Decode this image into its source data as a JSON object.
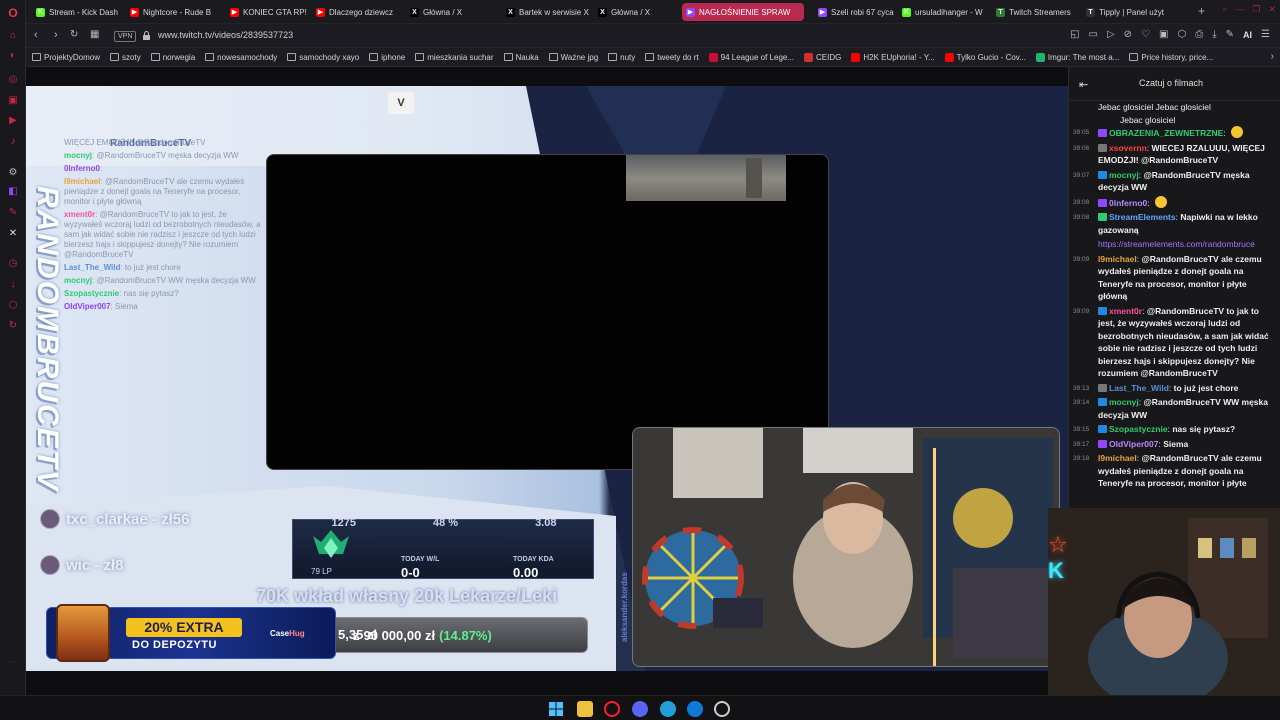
{
  "browser": {
    "tabs": [
      {
        "label": "Stream - Kick Dash",
        "fav": "K",
        "color": "#53fc18"
      },
      {
        "label": "Nightcore - Rude B",
        "fav": "▶",
        "color": "#ff0000"
      },
      {
        "label": "KONIEC GTA RP! M",
        "fav": "▶",
        "color": "#ff0000"
      },
      {
        "label": "Dlaczego dziewcz",
        "fav": "▶",
        "color": "#ff0000"
      },
      {
        "label": "Główna / X",
        "fav": "X",
        "color": "#000000"
      },
      {
        "label": "Bartek w serwisie X",
        "fav": "X",
        "color": "#000000"
      },
      {
        "label": "Główna / X",
        "fav": "X",
        "color": "#000000"
      },
      {
        "label": "NAGŁOŚNIENIE SPRAW",
        "fav": "▶",
        "color": "#9146ff",
        "active": true
      },
      {
        "label": "Szeli robi 67 cycam",
        "fav": "▶",
        "color": "#9146ff"
      },
      {
        "label": "ursuladihanger - W",
        "fav": "K",
        "color": "#53fc18"
      },
      {
        "label": "Twitch Streamers",
        "fav": "T",
        "color": "#2e7d32"
      },
      {
        "label": "Tipply | Panel użyt",
        "fav": "T",
        "color": "#333333"
      }
    ],
    "url": "www.twitch.tv/videos/2839537723",
    "vpn_label": "VPN",
    "ai_label": "AI",
    "bookmarks": [
      {
        "label": "ProjektyDomow",
        "type": "folder"
      },
      {
        "label": "szoty",
        "type": "folder"
      },
      {
        "label": "norwegia",
        "type": "folder"
      },
      {
        "label": "nowesamochody",
        "type": "folder"
      },
      {
        "label": "samochody xayo",
        "type": "folder"
      },
      {
        "label": "iphone",
        "type": "folder"
      },
      {
        "label": "mieszkania suchar",
        "type": "folder"
      },
      {
        "label": "Nauka",
        "type": "folder"
      },
      {
        "label": "Ważne jpg",
        "type": "folder"
      },
      {
        "label": "nuty",
        "type": "folder"
      },
      {
        "label": "tweety do rt",
        "type": "folder"
      },
      {
        "label": "94 League of Lege...",
        "type": "site",
        "color": "#c8102e"
      },
      {
        "label": "CEIDG",
        "type": "site",
        "color": "#d32f2f"
      },
      {
        "label": "H2K EUphoria! - Y...",
        "type": "site",
        "color": "#ff0000"
      },
      {
        "label": "Tylko Gucio - Cov...",
        "type": "site",
        "color": "#ff0000"
      },
      {
        "label": "Imgur: The most a...",
        "type": "site",
        "color": "#1bb76e"
      },
      {
        "label": "Price history, price...",
        "type": "folder"
      }
    ]
  },
  "stream": {
    "vertical_name": "RANDOMBRUCETV",
    "overlay_chat_header": "RandomBruceTV",
    "overlay_chat": [
      {
        "user": "",
        "text": "WIĘCEJ EMODŻJI! @RandomBruceTV",
        "color": "#8a97b0"
      },
      {
        "user": "mocnyj",
        "text": "@RandomBruceTV męska decyzja WW",
        "color": "#2ecc71"
      },
      {
        "user": "0lnferno0",
        "text": "",
        "color": "#8e44ff"
      },
      {
        "user": "l9michael",
        "text": "@RandomBruceTV ale czemu wydałeś pieniądze z donejt goala na Teneryfe na procesor, monitor i płyte główną",
        "color": "#e5a33b"
      },
      {
        "user": "xment0r",
        "text": "@RandomBruceTV to jak to jest, że wyzywałeś wczoraj ludzi od bezrobotnych nieudasów, a sam jak widać sobie nie radzisz i jeszcze od tych ludzi bierzesz hajs i skippujesz donejty? Nie rozumiem @RandomBruceTV",
        "color": "#ff4fa0"
      },
      {
        "user": "Last_The_Wild",
        "text": "to już jest chore",
        "color": "#5b8fd6"
      },
      {
        "user": "mocnyj",
        "text": "@RandomBruceTV WW męska decyzja WW",
        "color": "#2ecc71"
      },
      {
        "user": "Szopastycznie",
        "text": "nas się pytasz?",
        "color": "#2ecc71"
      },
      {
        "user": "OldViper007",
        "text": "Siema",
        "color": "#8e44ff"
      }
    ],
    "donations": [
      {
        "text": "txc_clarkae - zł56"
      },
      {
        "text": "wic - zł8"
      }
    ],
    "stats": {
      "top_values": [
        "1275",
        "48 %",
        "3.08"
      ],
      "lp": "79 LP",
      "today_wl_label": "TODAY W/L",
      "today_wl": "0-0",
      "today_kda_label": "TODAY KDA",
      "today_kda": "0.00"
    },
    "goal": {
      "title": "70K wkład własny 20k Lekarze/Leki",
      "current": "5,35 zł",
      "separator": "z",
      "target": "90 000,00 zł",
      "percent": "(14.87%)",
      "fraction": 0.1487
    },
    "promo": {
      "main": "20% EXTRA",
      "sub": "DO DEPOZYTU",
      "brand_a": "Case",
      "brand_b": "Hug"
    },
    "handle": "aleksander.kordas"
  },
  "chat": {
    "title": "Czatuj o filmach",
    "top_lines": [
      "Jebac glosiciel   Jebac glosiciel",
      "Jebac glosiciel"
    ],
    "messages": [
      {
        "ts": "39:05",
        "user": "OBRAZENIA_ZEWNETRZNE",
        "text": "",
        "color": "#2ecc71",
        "badge": "#9146ff",
        "emote": true
      },
      {
        "ts": "39:06",
        "user": "xsovernn",
        "text": "WIECEJ RZALUUU, WIĘCEJ EMODŻJI! @RandomBruceTV",
        "color": "#ff4040",
        "badge": "#777"
      },
      {
        "ts": "39:07",
        "user": "mocnyj",
        "text": "@RandomBruceTV męska decyzja WW",
        "color": "#2ecc71",
        "badge": "#1e88e5"
      },
      {
        "ts": "39:08",
        "user": "0lnferno0",
        "text": "",
        "color": "#b987ff",
        "badge": "#9146ff",
        "emote": true
      },
      {
        "ts": "39:08",
        "user": "StreamElements",
        "text": "Napiwki na w lekko gazowaną",
        "color": "#5ca8ff",
        "badge": "#2ecc71"
      },
      {
        "ts": "",
        "user": "",
        "text": "https://streamelements.com/randombruce",
        "color": "#a970ff",
        "link": true
      },
      {
        "ts": "39:09",
        "user": "l9michael",
        "text": "@RandomBruceTV ale czemu wydałeś pieniądze z donejt goala na Teneryfe na procesor, monitor i płyte główną",
        "color": "#e5a33b"
      },
      {
        "ts": "39:09",
        "user": "xment0r",
        "text": "@RandomBruceTV to jak to jest, że wyzywałeś wczoraj ludzi od bezrobotnych nieudasów, a sam jak widać sobie nie radzisz i jeszcze od tych ludzi bierzesz hajs i skippujesz donejty? Nie rozumiem @RandomBruceTV",
        "color": "#ff4fa0",
        "badge": "#1e88e5"
      },
      {
        "ts": "39:13",
        "user": "Last_The_Wild",
        "text": "to już jest chore",
        "color": "#5b8fd6",
        "badge": "#777"
      },
      {
        "ts": "39:14",
        "user": "mocnyj",
        "text": "@RandomBruceTV WW męska decyzja WW",
        "color": "#2ecc71",
        "badge": "#1e88e5"
      },
      {
        "ts": "39:15",
        "user": "Szopastycznie",
        "text": "nas się pytasz?",
        "color": "#2ecc71",
        "badge": "#1e88e5"
      },
      {
        "ts": "39:17",
        "user": "OldViper007",
        "text": "Siema",
        "color": "#b987ff",
        "badge": "#9146ff"
      },
      {
        "ts": "39:18",
        "user": "l9michael",
        "text": "@RandomBruceTV ale czemu wydałeś pieniądze z donejt goala na Teneryfe na procesor, monitor i płyte",
        "color": "#e5a33b"
      }
    ]
  }
}
